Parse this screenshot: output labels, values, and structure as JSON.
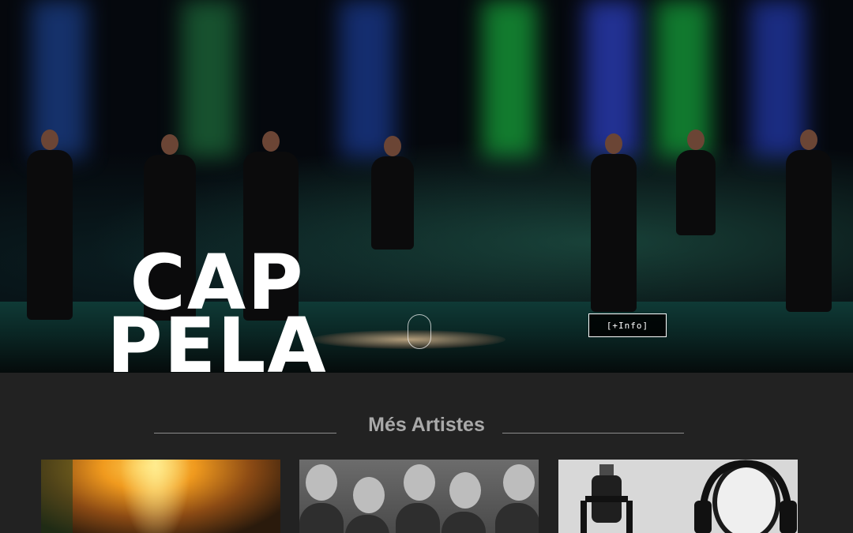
{
  "hero": {
    "title_line1": "CAP",
    "title_line2": "PELA",
    "info_button": "[+Info]"
  },
  "section": {
    "title": "Més Artistes"
  },
  "cards": [
    {
      "image": "stage-lights-photo"
    },
    {
      "image": "group-portrait-photo"
    },
    {
      "image": "microphone-radio-photo"
    }
  ],
  "colors": {
    "page_bg": "#222222",
    "section_title": "#a9a9a9",
    "accent_white": "#ffffff"
  }
}
